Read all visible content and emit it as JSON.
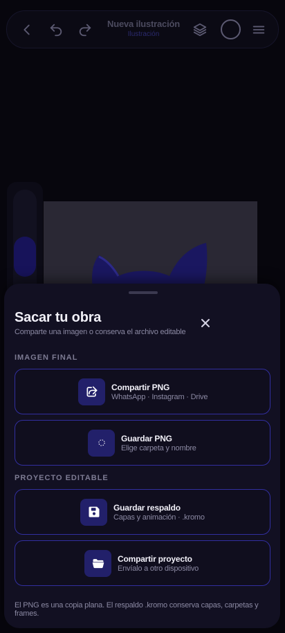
{
  "toolbar": {
    "title": "Nueva ilustración",
    "subtitle": "Ilustración",
    "icons": [
      "chevron-left-icon",
      "undo-icon",
      "redo-icon",
      "layers-icon",
      "color-ring",
      "menu-icon"
    ]
  },
  "sheet": {
    "title": "Sacar tu obra",
    "subtitle": "Comparte una imagen o conserva el archivo editable",
    "sections": {
      "final_image": "IMAGEN FINAL",
      "editable_project": "PROYECTO EDITABLE"
    },
    "options": [
      {
        "title": "Compartir PNG",
        "detail": "WhatsApp · Instagram · Drive",
        "icon": "share-icon"
      },
      {
        "title": "Guardar PNG",
        "detail": "Elige carpeta y nombre",
        "icon": "loading-spinner-icon"
      },
      {
        "title": "Guardar respaldo",
        "detail": "Capas y animación · .kromo",
        "icon": "save-icon"
      },
      {
        "title": "Compartir proyecto",
        "detail": "Envíalo a otro dispositivo",
        "icon": "folder-open-icon"
      }
    ],
    "footnote": "El PNG es una copia plana. El respaldo .kromo conserva capas, carpetas y frames."
  },
  "colors": {
    "background": "#07060d",
    "sheet": "#121022",
    "accent_border": "#322fa0",
    "icon_tile": "#22206a"
  }
}
